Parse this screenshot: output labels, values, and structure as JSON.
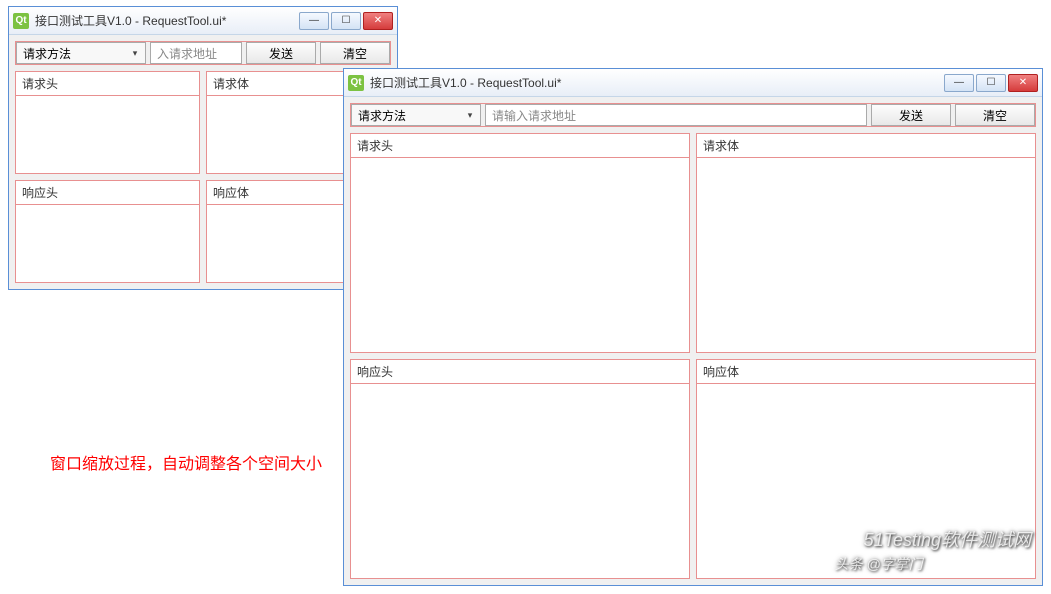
{
  "window_small": {
    "title": "接口测试工具V1.0 - RequestTool.ui*",
    "toolbar": {
      "method_label": "请求方法",
      "address_placeholder": "入请求地址",
      "send_label": "发送",
      "clear_label": "清空"
    },
    "panels": {
      "req_header": "请求头",
      "req_body": "请求体",
      "res_header": "响应头",
      "res_body": "响应体"
    }
  },
  "window_large": {
    "title": "接口测试工具V1.0 - RequestTool.ui*",
    "toolbar": {
      "method_label": "请求方法",
      "address_placeholder": "请输入请求地址",
      "send_label": "发送",
      "clear_label": "清空"
    },
    "panels": {
      "req_header": "请求头",
      "req_body": "请求体",
      "res_header": "响应头",
      "res_body": "响应体"
    }
  },
  "annotation": "窗口缩放过程，自动调整各个空间大小",
  "watermark": {
    "line1": "51Testing软件测试网",
    "line2": "头条 @字掌门"
  },
  "qt_icon_text": "Qt"
}
